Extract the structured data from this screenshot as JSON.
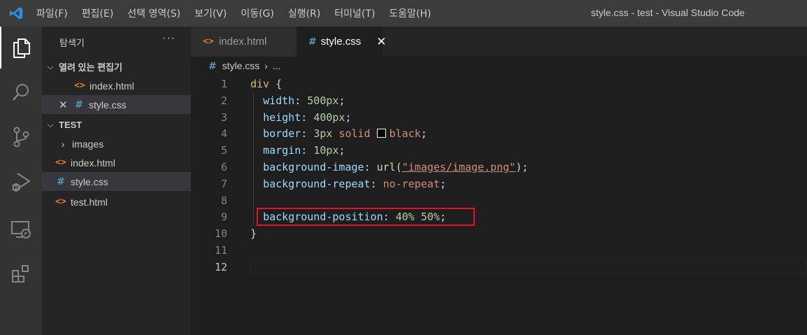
{
  "menu": [
    "파일(F)",
    "편집(E)",
    "선택 영역(S)",
    "보기(V)",
    "이동(G)",
    "실행(R)",
    "터미널(T)",
    "도움말(H)"
  ],
  "window_title": "style.css - test - Visual Studio Code",
  "activity_icons": [
    "files-icon",
    "search-icon",
    "source-control-icon",
    "run-debug-icon",
    "remote-explorer-icon",
    "extensions-icon"
  ],
  "sidebar": {
    "header": "탐색기",
    "more": "···",
    "open_editors": {
      "title": "열려 있는 편집기",
      "items": [
        {
          "name": "index.html",
          "type": "html"
        },
        {
          "name": "style.css",
          "type": "css",
          "selected": true
        }
      ]
    },
    "workspace": {
      "title": "TEST",
      "items": [
        {
          "name": "images",
          "type": "folder"
        },
        {
          "name": "index.html",
          "type": "html"
        },
        {
          "name": "style.css",
          "type": "css",
          "selected": true
        },
        {
          "name": "test.html",
          "type": "html"
        }
      ]
    }
  },
  "tabs": [
    {
      "label": "index.html",
      "type": "html",
      "active": false
    },
    {
      "label": "style.css",
      "type": "css",
      "active": true
    }
  ],
  "breadcrumb": {
    "file": "style.css",
    "rest": "..."
  },
  "code_lines": [
    {
      "n": "1",
      "tokens": [
        [
          "sel",
          "div"
        ],
        [
          "p",
          " {"
        ]
      ]
    },
    {
      "n": "2",
      "tokens": [
        [
          "prop",
          "width"
        ],
        [
          "p",
          ": "
        ],
        [
          "num",
          "500px"
        ],
        [
          "p",
          ";"
        ]
      ]
    },
    {
      "n": "3",
      "tokens": [
        [
          "prop",
          "height"
        ],
        [
          "p",
          ": "
        ],
        [
          "num",
          "400px"
        ],
        [
          "p",
          ";"
        ]
      ]
    },
    {
      "n": "4",
      "tokens": [
        [
          "prop",
          "border"
        ],
        [
          "p",
          ": "
        ],
        [
          "num",
          "3px"
        ],
        [
          "p",
          " "
        ],
        [
          "kw",
          "solid"
        ],
        [
          "p",
          " "
        ],
        [
          "swatch",
          ""
        ],
        [
          "kw",
          "black"
        ],
        [
          "p",
          ";"
        ]
      ]
    },
    {
      "n": "5",
      "tokens": [
        [
          "prop",
          "margin"
        ],
        [
          "p",
          ": "
        ],
        [
          "num",
          "10px"
        ],
        [
          "p",
          ";"
        ]
      ]
    },
    {
      "n": "6",
      "tokens": [
        [
          "prop",
          "background-image"
        ],
        [
          "p",
          ": "
        ],
        [
          "fn",
          "url"
        ],
        [
          "p",
          "("
        ],
        [
          "str",
          "\"images/image.png\""
        ],
        [
          "p",
          ");"
        ]
      ]
    },
    {
      "n": "7",
      "tokens": [
        [
          "prop",
          "background-repeat"
        ],
        [
          "p",
          ": "
        ],
        [
          "kw",
          "no-repeat"
        ],
        [
          "p",
          ";"
        ]
      ]
    },
    {
      "n": "8",
      "tokens": []
    },
    {
      "n": "9",
      "tokens": [
        [
          "prop",
          "background-position"
        ],
        [
          "p",
          ": "
        ],
        [
          "num",
          "40%"
        ],
        [
          "p",
          " "
        ],
        [
          "num",
          "50%"
        ],
        [
          "p",
          ";"
        ]
      ]
    },
    {
      "n": "10",
      "tokens": [
        [
          "p",
          "}"
        ]
      ]
    },
    {
      "n": "11",
      "tokens": []
    },
    {
      "n": "12",
      "tokens": []
    }
  ],
  "current_line": "12",
  "highlight_color": "#e81123"
}
